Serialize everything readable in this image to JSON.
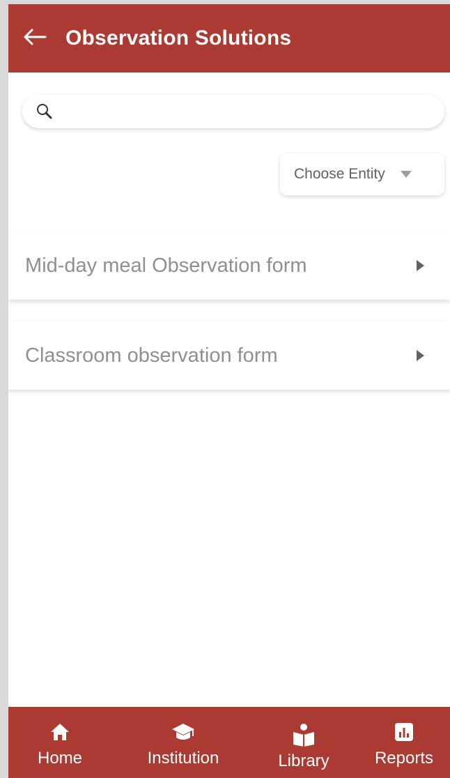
{
  "header": {
    "title": "Observation Solutions",
    "back_icon": "arrow-left-icon",
    "background": "#ab3a33"
  },
  "search": {
    "icon": "search-icon",
    "placeholder": "",
    "value": ""
  },
  "entity_filter": {
    "label": "Choose Entity",
    "icon": "caret-down-icon"
  },
  "solutions": [
    {
      "title": "Mid-day meal Observation form",
      "icon": "caret-right-icon"
    },
    {
      "title": "Classroom observation form",
      "icon": "caret-right-icon"
    }
  ],
  "bottom_nav": {
    "background": "#ab3a33",
    "items": [
      {
        "label": "Home",
        "icon": "home-icon"
      },
      {
        "label": "Institution",
        "icon": "graduation-cap-icon"
      },
      {
        "label": "Library",
        "icon": "reader-book-icon"
      },
      {
        "label": "Reports",
        "icon": "bar-chart-icon"
      }
    ]
  }
}
